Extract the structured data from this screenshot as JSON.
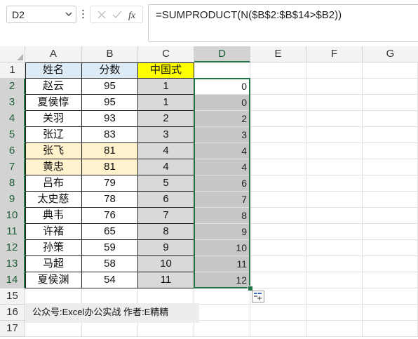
{
  "formula_bar": {
    "name_box": "D2",
    "formula": "=SUMPRODUCT(N($B$2:$B$14>$B2))"
  },
  "columns": [
    "A",
    "B",
    "C",
    "D",
    "E",
    "F",
    "G"
  ],
  "rows": [
    "1",
    "2",
    "3",
    "4",
    "5",
    "6",
    "7",
    "8",
    "9",
    "10",
    "11",
    "12",
    "13",
    "14",
    "15",
    "16",
    "17"
  ],
  "headers": {
    "A": "姓名",
    "B": "分数",
    "C": "中国式"
  },
  "table": [
    {
      "name": "赵云",
      "score": "95",
      "rank": "1",
      "d": "0"
    },
    {
      "name": "夏侯惇",
      "score": "95",
      "rank": "1",
      "d": "0"
    },
    {
      "name": "关羽",
      "score": "93",
      "rank": "2",
      "d": "2"
    },
    {
      "name": "张辽",
      "score": "83",
      "rank": "3",
      "d": "3"
    },
    {
      "name": "张飞",
      "score": "81",
      "rank": "4",
      "d": "4"
    },
    {
      "name": "黄忠",
      "score": "81",
      "rank": "4",
      "d": "4"
    },
    {
      "name": "吕布",
      "score": "79",
      "rank": "5",
      "d": "6"
    },
    {
      "name": "太史慈",
      "score": "78",
      "rank": "6",
      "d": "7"
    },
    {
      "name": "典韦",
      "score": "76",
      "rank": "7",
      "d": "8"
    },
    {
      "name": "许褚",
      "score": "65",
      "rank": "8",
      "d": "9"
    },
    {
      "name": "孙策",
      "score": "59",
      "rank": "9",
      "d": "10"
    },
    {
      "name": "马超",
      "score": "58",
      "rank": "10",
      "d": "11"
    },
    {
      "name": "夏侯渊",
      "score": "54",
      "rank": "11",
      "d": "12"
    }
  ],
  "footer_note": "公众号:Excel办公实战  作者:E精精",
  "colors": {
    "header_a_fill": "#ddebf7",
    "header_c_fill": "#ffff00",
    "highlight_fill": "#fff2cc",
    "rank_fill": "#d9d9d9",
    "selection_border": "#217346",
    "selection_fill": "#c6c6c6"
  }
}
